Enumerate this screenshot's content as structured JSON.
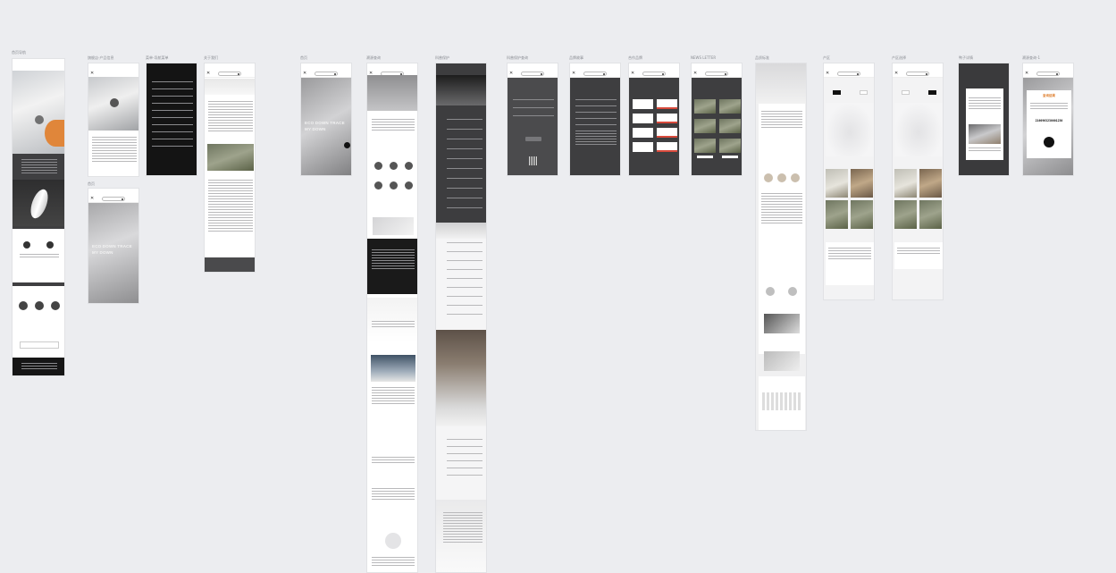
{
  "canvas": {
    "background": "#ecedf0",
    "accent_orange": "#e0863a",
    "accent_red": "#d84a3c"
  },
  "artboards": [
    {
      "id": "home",
      "label": "首页导航"
    },
    {
      "id": "product",
      "label": "旗舰店-产品信息"
    },
    {
      "id": "menu",
      "label": "菜单-导航菜单"
    },
    {
      "id": "about",
      "label": "关于我们"
    },
    {
      "id": "home2",
      "label": "首页"
    },
    {
      "id": "trace",
      "label": "溯源查询"
    },
    {
      "id": "protect",
      "label": "科普保护"
    },
    {
      "id": "protect-query",
      "label": "科普保护查询"
    },
    {
      "id": "brand",
      "label": "品牌故事"
    },
    {
      "id": "partner",
      "label": "合作品牌"
    },
    {
      "id": "newsletter",
      "label": "NEWS LETTER"
    },
    {
      "id": "standard",
      "label": "品质标准"
    },
    {
      "id": "region",
      "label": "产区"
    },
    {
      "id": "region2",
      "label": "产区选择"
    },
    {
      "id": "goose",
      "label": "鸭子详情"
    },
    {
      "id": "trace2",
      "label": "溯源查询-1"
    },
    {
      "id": "product-sub",
      "label": "首页"
    }
  ],
  "hero": {
    "line1": "ECO DOWN TRACE",
    "line2": "MY DOWN"
  },
  "trace_result": {
    "title": "查询结果",
    "code": "2160903230001230"
  },
  "icons": {
    "close": "close-icon",
    "play": "play-icon",
    "logo_pill": "brand-pill-icon"
  }
}
